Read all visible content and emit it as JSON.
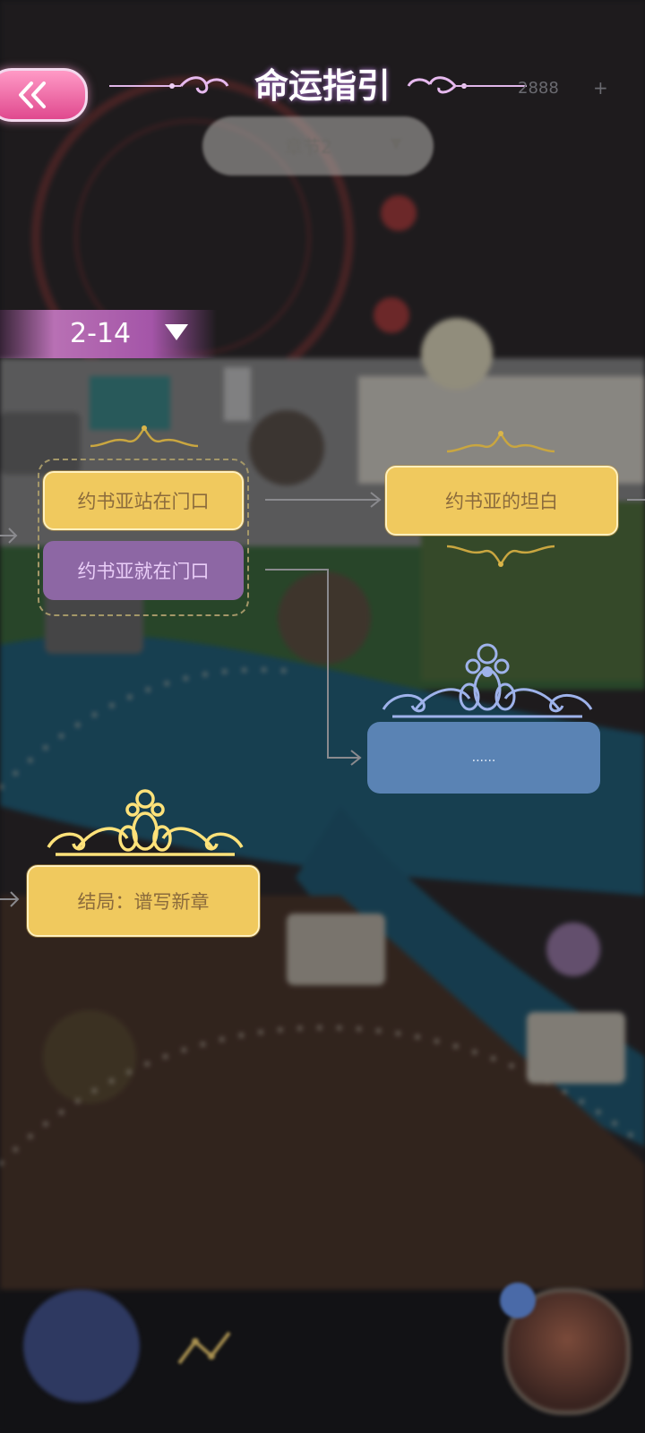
{
  "header": {
    "title": "命运指引",
    "currency_value": "2888",
    "currency_plus": "+"
  },
  "chapter_select": {
    "label": "章节2",
    "arrow": "▼"
  },
  "level_selector": {
    "label": "2-14"
  },
  "nodes": {
    "choice_a": "约书亚站在门口",
    "choice_b": "约书亚就在门口",
    "confession": "约书亚的坦白",
    "hidden": "......",
    "ending": "结局：谱写新章"
  },
  "colors": {
    "node_yellow": "#f0c95e",
    "node_purple": "#8d67a4",
    "node_blue": "#5a83b4",
    "back_button": "#e0498e",
    "level_bar": "#a455a8"
  },
  "icons": {
    "back": "double-chevron-left-icon",
    "book": "book-icon",
    "graph": "branch-graph-icon",
    "avatar": "character-avatar"
  }
}
